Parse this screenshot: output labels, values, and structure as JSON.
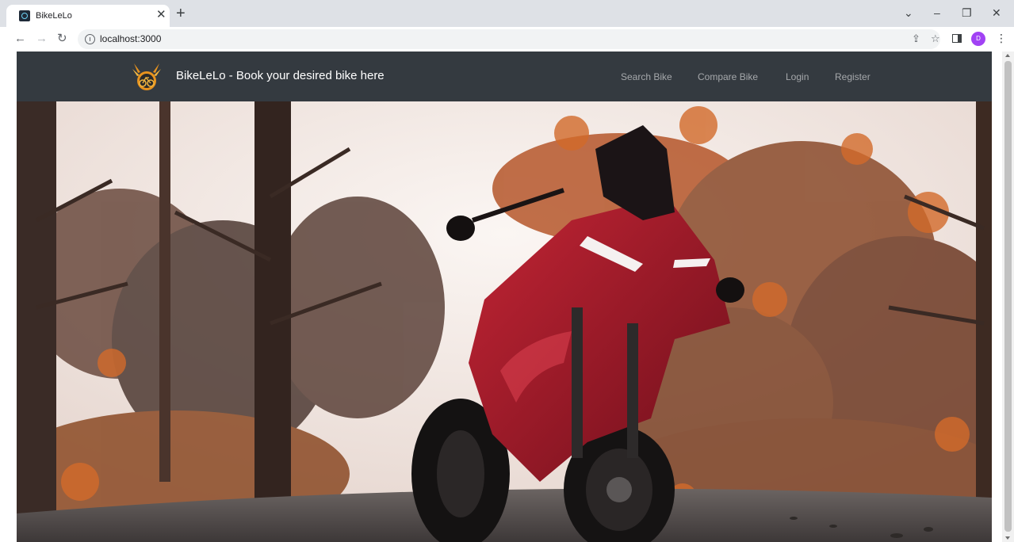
{
  "browser": {
    "tab_title": "BikeLeLo",
    "tab_close_glyph": "✕",
    "new_tab_glyph": "+",
    "url": "localhost:3000",
    "profile_initial": "D",
    "window_controls": {
      "tabsearch": "⌄",
      "minimize": "–",
      "restore": "❐",
      "close": "✕"
    },
    "icons": [
      "back-icon",
      "forward-icon",
      "reload-icon",
      "info-icon",
      "share-icon",
      "bookmark-star-icon",
      "side-panel-icon",
      "profile-avatar",
      "more-menu-icon"
    ]
  },
  "navbar": {
    "brand_text": "BikeLeLo - Book your desired bike here",
    "links": [
      "Search Bike",
      "Compare Bike",
      "Login",
      "Register"
    ]
  },
  "colors": {
    "navbar_bg": "#343a40",
    "nav_link": "rgba(255,255,255,0.55)",
    "brand_text": "#ffffff",
    "logo_orange": "#e8931e",
    "bike_red": "#a01726"
  }
}
